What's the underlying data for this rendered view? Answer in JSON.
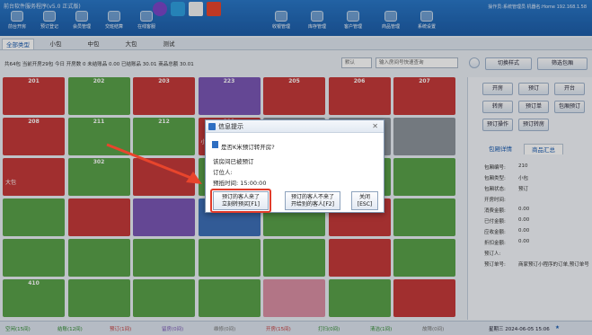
{
  "window": {
    "title": "前台软件服务程序(v5.0 正式版)",
    "user_info": "操作员:系统管理员  机器名:Home  192.168.1.58"
  },
  "toolbar": {
    "items": [
      {
        "label": "前台开房"
      },
      {
        "label": "预订登记"
      },
      {
        "label": "会员管理"
      },
      {
        "label": "交班结算"
      },
      {
        "label": "在线客服"
      },
      {
        "label": "收银管理"
      },
      {
        "label": "库存管理"
      },
      {
        "label": "客户管理"
      },
      {
        "label": "商品管理"
      },
      {
        "label": "系统设置"
      }
    ]
  },
  "tabs": {
    "items": [
      {
        "label": "全部类型"
      },
      {
        "label": "小包"
      },
      {
        "label": "中包"
      },
      {
        "label": "大包"
      },
      {
        "label": "测试"
      }
    ],
    "active": 0
  },
  "status": {
    "summary": "共64包 当前开房29包 今日 开房数 0 未结账品 0.00 已结账品 30.01 商品总额 30.01"
  },
  "filter": {
    "select_value": "默认",
    "search_placeholder": "输入房间号快速查询"
  },
  "actions": {
    "switch_mode": "切换样式",
    "filter_room": "筛选包厢"
  },
  "rooms": [
    {
      "no": "201",
      "label": "",
      "time": "",
      "color": "r"
    },
    {
      "no": "202",
      "label": "",
      "time": "",
      "color": "g"
    },
    {
      "no": "203",
      "label": "",
      "time": "",
      "color": "r"
    },
    {
      "no": "223",
      "label": "",
      "time": "",
      "color": "p"
    },
    {
      "no": "205",
      "label": "",
      "time": "",
      "color": "r"
    },
    {
      "no": "206",
      "label": "",
      "time": "",
      "color": "r"
    },
    {
      "no": "207",
      "label": "",
      "time": "",
      "color": "r"
    },
    {
      "no": "208",
      "label": "",
      "time": "",
      "color": "r"
    },
    {
      "no": "211",
      "label": "",
      "time": "",
      "color": "g"
    },
    {
      "no": "212",
      "label": "",
      "time": "",
      "color": "g"
    },
    {
      "no": "211",
      "label": "小包",
      "time": "",
      "color": "r"
    },
    {
      "no": "",
      "label": "",
      "time": "",
      "color": "gr"
    },
    {
      "no": "",
      "label": "",
      "time": "",
      "color": "gr"
    },
    {
      "no": "",
      "label": "",
      "time": "",
      "color": "gr"
    },
    {
      "no": "",
      "label": "大包",
      "time": "",
      "color": "r"
    },
    {
      "no": "302",
      "label": "",
      "time": "",
      "color": "g"
    },
    {
      "no": "",
      "label": "",
      "time": "",
      "color": "r"
    },
    {
      "no": "",
      "label": "",
      "time": "",
      "color": "g"
    },
    {
      "no": "",
      "label": "",
      "time": "",
      "color": "r"
    },
    {
      "no": "",
      "label": "",
      "time": "",
      "color": "g"
    },
    {
      "no": "",
      "label": "",
      "time": "",
      "color": "g"
    },
    {
      "no": "",
      "label": "",
      "time": "",
      "color": "g"
    },
    {
      "no": "",
      "label": "",
      "time": "",
      "color": "r"
    },
    {
      "no": "",
      "label": "",
      "time": "",
      "color": "p"
    },
    {
      "no": "311",
      "label": "",
      "time": "",
      "color": "b"
    },
    {
      "no": "312",
      "label": "",
      "time": "",
      "color": "g"
    },
    {
      "no": "401",
      "label": "",
      "time": "",
      "color": "r"
    },
    {
      "no": "",
      "label": "",
      "time": "",
      "color": "g"
    },
    {
      "no": "",
      "label": "",
      "time": "",
      "color": "g"
    },
    {
      "no": "",
      "label": "",
      "time": "",
      "color": "g"
    },
    {
      "no": "",
      "label": "",
      "time": "",
      "color": "g"
    },
    {
      "no": "",
      "label": "",
      "time": "",
      "color": "g"
    },
    {
      "no": "",
      "label": "",
      "time": "",
      "color": "g"
    },
    {
      "no": "",
      "label": "",
      "time": "",
      "color": "r"
    },
    {
      "no": "",
      "label": "",
      "time": "",
      "color": "g"
    },
    {
      "no": "410",
      "label": "",
      "time": "",
      "color": "g"
    },
    {
      "no": "",
      "label": "",
      "time": "",
      "color": "g"
    },
    {
      "no": "",
      "label": "",
      "time": "",
      "color": "g"
    },
    {
      "no": "",
      "label": "",
      "time": "",
      "color": "g"
    },
    {
      "no": "",
      "label": "",
      "time": "",
      "color": "pk"
    },
    {
      "no": "",
      "label": "",
      "time": "",
      "color": "g"
    },
    {
      "no": "",
      "label": "",
      "time": "",
      "color": "r"
    },
    {
      "no": "",
      "label": "",
      "time": "",
      "color": "g"
    },
    {
      "no": "",
      "label": "",
      "time": "",
      "color": "g"
    },
    {
      "no": "",
      "label": "",
      "time": "",
      "color": "g"
    },
    {
      "no": "",
      "label": "",
      "time": "",
      "color": "g"
    },
    {
      "no": "",
      "label": "",
      "time": "",
      "color": "g"
    },
    {
      "no": "",
      "label": "",
      "time": "",
      "color": "g"
    }
  ],
  "right_panel": {
    "buttons": [
      "开房",
      "预订",
      "开台",
      "转房",
      "预订单",
      "包厢预订",
      "预订操作",
      "预订转房"
    ],
    "tabs": [
      "包厢详情",
      "商品汇总"
    ],
    "details": [
      {
        "k": "包厢编号:",
        "v": "210"
      },
      {
        "k": "包厢类型:",
        "v": "小包"
      },
      {
        "k": "包厢状态:",
        "v": "预订"
      },
      {
        "k": "开房时间:",
        "v": ""
      },
      {
        "k": "消费金额:",
        "v": "0.00"
      },
      {
        "k": "已付金额:",
        "v": "0.00"
      },
      {
        "k": "应收金额:",
        "v": "0.00"
      },
      {
        "k": "折扣金额:",
        "v": "0.00"
      },
      {
        "k": "预订人:",
        "v": ""
      },
      {
        "k": "预订单号:",
        "v": "商家预订小程序的订单,预订单号"
      }
    ]
  },
  "legend": {
    "items": [
      {
        "label": "空闲(15间)",
        "color": "#2f8a2f"
      },
      {
        "label": "结账(12间)",
        "color": "#2f8a2f"
      },
      {
        "label": "预订(1间)",
        "color": "#c53a3a"
      },
      {
        "label": "留房(0间)",
        "color": "#7a57b5"
      },
      {
        "label": "维修(0间)",
        "color": "#777"
      },
      {
        "label": "开房(15间)",
        "color": "#c53a3a"
      },
      {
        "label": "打扫(0间)",
        "color": "#2f8a2f"
      },
      {
        "label": "清洁(1间)",
        "color": "#2f8a2f"
      },
      {
        "label": "故障(0间)",
        "color": "#777"
      }
    ],
    "datetime": "星期三 2024-06-05 15:06"
  },
  "dialog": {
    "title": "信息提示",
    "question": "是否K米预订转开房?",
    "line1": "该房间已被预订",
    "line2": "订位人:",
    "line3": "预抵时间: 15:00:00",
    "btn_arrived": "预订的客人来了\n立刻转预买[F1]",
    "btn_not_arrived": "预订的客人不来了\n开给别的客人[F2]",
    "btn_close": "关闭\n[ESC]"
  }
}
